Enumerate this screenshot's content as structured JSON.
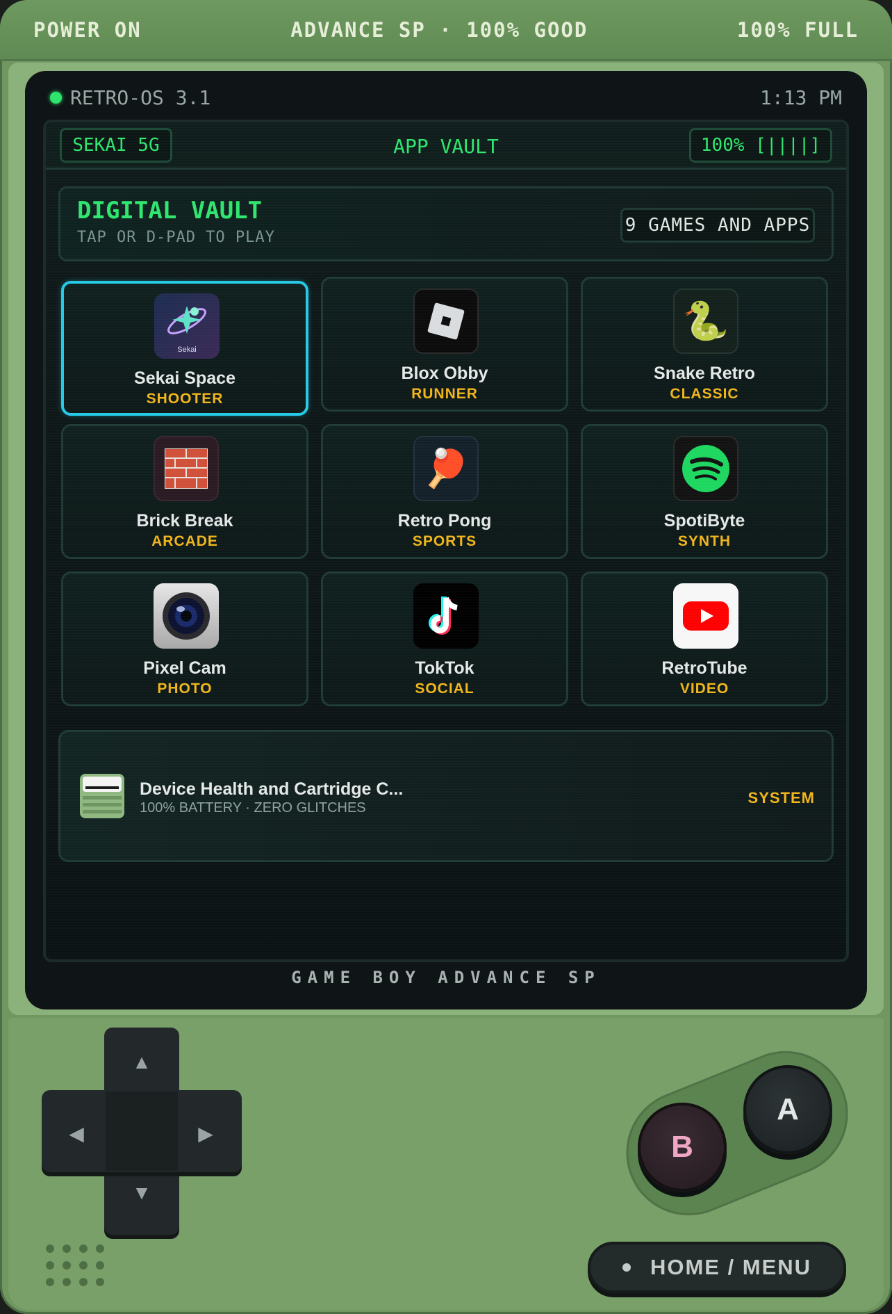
{
  "topbar": {
    "left": "POWER ON",
    "center": "ADVANCE SP · 100% GOOD",
    "right": "100% FULL"
  },
  "os": {
    "name": "RETRO-OS 3.1",
    "time": "1:13 PM"
  },
  "app_header": {
    "network": "SEKAI 5G",
    "title": "APP VAULT",
    "battery": "100% [||||]"
  },
  "vault": {
    "title": "DIGITAL VAULT",
    "subtitle": "TAP OR D-PAD TO PLAY",
    "count": "9 GAMES AND APPS"
  },
  "apps": [
    {
      "name": "Sekai Space",
      "category": "SHOOTER",
      "icon": "sekai-space-icon",
      "icon_label": "Sekai",
      "selected": true
    },
    {
      "name": "Blox Obby",
      "category": "RUNNER",
      "icon": "blox-obby-icon"
    },
    {
      "name": "Snake Retro",
      "category": "CLASSIC",
      "icon": "snake-icon",
      "glyph": "🐍"
    },
    {
      "name": "Brick Break",
      "category": "ARCADE",
      "icon": "brick-icon",
      "glyph": "🧱"
    },
    {
      "name": "Retro Pong",
      "category": "SPORTS",
      "icon": "ping-pong-icon",
      "glyph": "🏓"
    },
    {
      "name": "SpotiByte",
      "category": "SYNTH",
      "icon": "spotify-icon"
    },
    {
      "name": "Pixel Cam",
      "category": "PHOTO",
      "icon": "camera-lens-icon"
    },
    {
      "name": "TokTok",
      "category": "SOCIAL",
      "icon": "tiktok-icon"
    },
    {
      "name": "RetroTube",
      "category": "VIDEO",
      "icon": "youtube-play-icon"
    }
  ],
  "system": {
    "title": "Device Health and Cartridge C...",
    "subtitle": "100% BATTERY · ZERO GLITCHES",
    "tag": "SYSTEM",
    "icon": "cartridge-icon"
  },
  "bezel_label": "GAME BOY ADVANCE SP",
  "controls": {
    "dpad_up": "▲",
    "dpad_down": "▼",
    "dpad_left": "◀",
    "dpad_right": "▶",
    "button_a": "A",
    "button_b": "B",
    "home": "HOME / MENU"
  },
  "colors": {
    "shell": "#6f975f",
    "accent_green": "#2ee66e",
    "accent_yellow": "#f1b51c",
    "selection": "#25c9e6"
  }
}
